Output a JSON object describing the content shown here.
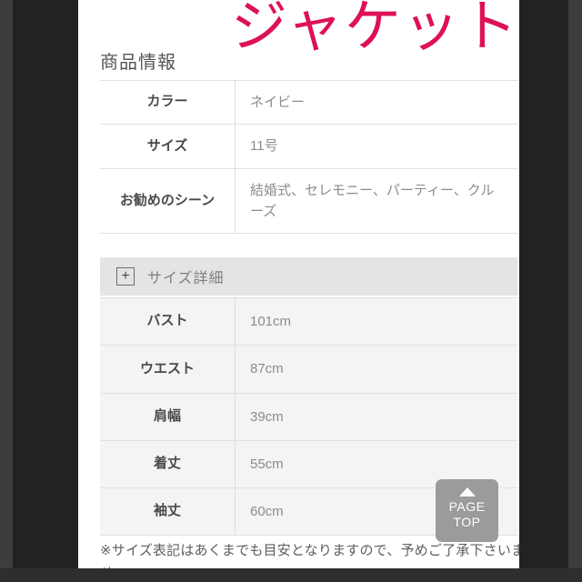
{
  "page": {
    "title": "商品情報",
    "overlay_text": "ジャケット",
    "overlay_color": "#dd1155"
  },
  "product_info": {
    "rows": [
      {
        "label": "カラー",
        "value": "ネイビー"
      },
      {
        "label": "サイズ",
        "value": "11号"
      },
      {
        "label": "お勧めのシーン",
        "value": "結婚式、セレモニー、パーティー、クルーズ"
      }
    ]
  },
  "size_detail": {
    "toggle_icon": "plus-icon",
    "toggle_symbol": "+",
    "label": "サイズ詳細",
    "rows": [
      {
        "label": "バスト",
        "value": "101cm"
      },
      {
        "label": "ウエスト",
        "value": "87cm"
      },
      {
        "label": "肩幅",
        "value": "39cm"
      },
      {
        "label": "着丈",
        "value": "55cm"
      },
      {
        "label": "袖丈",
        "value": "60cm"
      }
    ]
  },
  "footnote": {
    "text": "※サイズ表記はあくまでも目安となりますので、予めご了承下さいませ。"
  },
  "page_top_button": {
    "icon": "triangle-up-icon",
    "line1": "PAGE",
    "line2": "TOP"
  }
}
